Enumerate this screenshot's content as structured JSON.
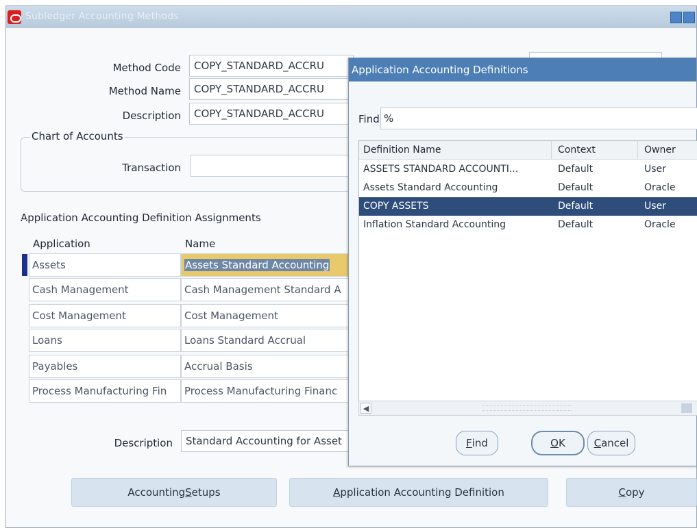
{
  "window": {
    "title": "Subledger Accounting Methods"
  },
  "form": {
    "method_code_label": "Method Code",
    "method_code_value": "COPY_STANDARD_ACCRU",
    "method_name_label": "Method Name",
    "method_name_value": "COPY_STANDARD_ACCRU",
    "description_label": "Description",
    "description_value": "COPY_STANDARD_ACCRU",
    "chart_of_accounts_title": "Chart of Accounts",
    "transaction_label": "Transaction",
    "transaction_value": ""
  },
  "assignments": {
    "title": "Application Accounting Definition Assignments",
    "col_application": "Application",
    "col_name": "Name",
    "rows": [
      {
        "application": "Assets",
        "name": "Assets Standard Accounting"
      },
      {
        "application": "Cash Management",
        "name": "Cash Management Standard A"
      },
      {
        "application": "Cost Management",
        "name": "Cost Management"
      },
      {
        "application": "Loans",
        "name": "Loans Standard Accrual"
      },
      {
        "application": "Payables",
        "name": "Accrual Basis"
      },
      {
        "application": "Process Manufacturing Fin",
        "name": "Process Manufacturing Financ"
      }
    ],
    "description_label": "Description",
    "description_value": "Standard Accounting for Asset"
  },
  "buttons": {
    "accounting_setups_pre": "Accounting ",
    "accounting_setups_u": "S",
    "accounting_setups_post": "etups",
    "aad_u": "A",
    "aad_post": "pplication Accounting Definition",
    "copy_u": "C",
    "copy_post": "opy"
  },
  "dialog": {
    "title": "Application Accounting Definitions",
    "find_label": "Find",
    "find_value": "%",
    "columns": [
      "Definition Name",
      "Context",
      "Owner"
    ],
    "rows": [
      {
        "name": "ASSETS STANDARD ACCOUNTI...",
        "context": "Default",
        "owner": "User"
      },
      {
        "name": "Assets Standard Accounting",
        "context": "Default",
        "owner": "Oracle"
      },
      {
        "name": "COPY ASSETS",
        "context": "Default",
        "owner": "User"
      },
      {
        "name": "Inflation Standard Accounting",
        "context": "Default",
        "owner": "Oracle"
      }
    ],
    "selected_index": 2,
    "find_btn_u": "F",
    "find_btn_post": "ind",
    "ok_btn_u": "O",
    "ok_btn_post": "K",
    "cancel_btn_u": "C",
    "cancel_btn_post": "ancel"
  },
  "colors": {
    "titlebar": "#b7cadc",
    "dialog_titlebar": "#4d7eb5",
    "selection": "#2e4d7b",
    "field_highlight": "#e8c96c"
  }
}
